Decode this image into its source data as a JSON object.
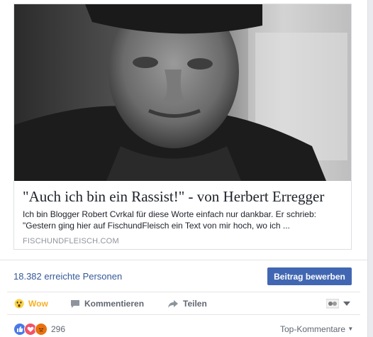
{
  "link_preview": {
    "title": "\"Auch ich bin ein Rassist!\" - von Herbert Erregger",
    "description_line1": "Ich bin Blogger Robert Cvrkal für diese Worte einfach nur dankbar. Er schrieb:",
    "description_line2": "\"Gestern ging hier auf FischundFleisch ein Text von mir hoch, wo ich ...",
    "domain": "FISCHUNDFLEISCH.COM"
  },
  "reach": {
    "text": "18.382 erreichte Personen",
    "promote_label": "Beitrag bewerben"
  },
  "actions": {
    "wow": "Wow",
    "comment": "Kommentieren",
    "share": "Teilen"
  },
  "reactions": {
    "count": "296",
    "sort_label": "Top-Kommentare",
    "colors": {
      "like": "#4a79e6",
      "love": "#f25268",
      "angry": "#e9710f"
    }
  }
}
